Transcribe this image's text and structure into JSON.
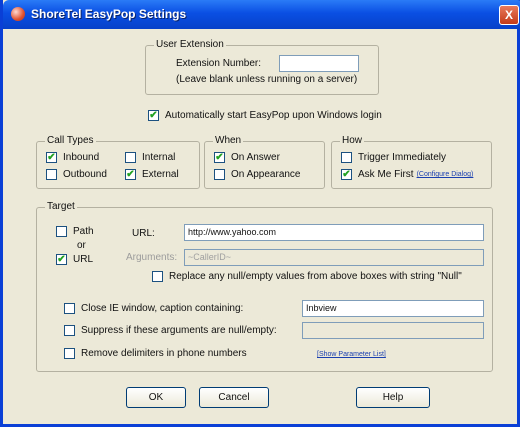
{
  "window": {
    "title": "ShoreTel EasyPop Settings",
    "close_label": "X"
  },
  "user_extension": {
    "legend": "User Extension",
    "number_label": "Extension Number:",
    "number_value": "",
    "note": "(Leave blank unless running on a server)"
  },
  "autostart": {
    "label": "Automatically start EasyPop upon Windows login",
    "checked": true
  },
  "call_types": {
    "legend": "Call Types",
    "inbound": {
      "label": "Inbound",
      "checked": true
    },
    "internal": {
      "label": "Internal",
      "checked": false
    },
    "outbound": {
      "label": "Outbound",
      "checked": false
    },
    "external": {
      "label": "External",
      "checked": true
    }
  },
  "when": {
    "legend": "When",
    "on_answer": {
      "label": "On Answer",
      "checked": true
    },
    "on_appearance": {
      "label": "On Appearance",
      "checked": false
    }
  },
  "how": {
    "legend": "How",
    "trigger_immediately": {
      "label": "Trigger Immediately",
      "checked": false
    },
    "ask_me_first": {
      "label": "Ask Me First",
      "checked": true
    },
    "configure_dialog_link": "(Configure Dialog)"
  },
  "target": {
    "legend": "Target",
    "path": {
      "label": "Path",
      "checked": false
    },
    "or_label": "or",
    "url_option": {
      "label": "URL",
      "checked": true
    },
    "url_label": "URL:",
    "url_value": "http://www.yahoo.com",
    "arguments_label": "Arguments:",
    "arguments_value": "~CallerID~",
    "replace_null": {
      "label": "Replace any null/empty values from above boxes with string \"Null\"",
      "checked": false
    },
    "close_ie": {
      "label": "Close IE window, caption containing:",
      "checked": false,
      "value": "Inbview"
    },
    "suppress": {
      "label": "Suppress if these arguments are null/empty:",
      "checked": false,
      "value": ""
    },
    "remove_delimiters": {
      "label": "Remove delimiters in phone numbers",
      "checked": false
    },
    "show_parameter_list_link": "[Show Parameter List]"
  },
  "buttons": {
    "ok": "OK",
    "cancel": "Cancel",
    "help": "Help"
  },
  "check_mark": "✔"
}
